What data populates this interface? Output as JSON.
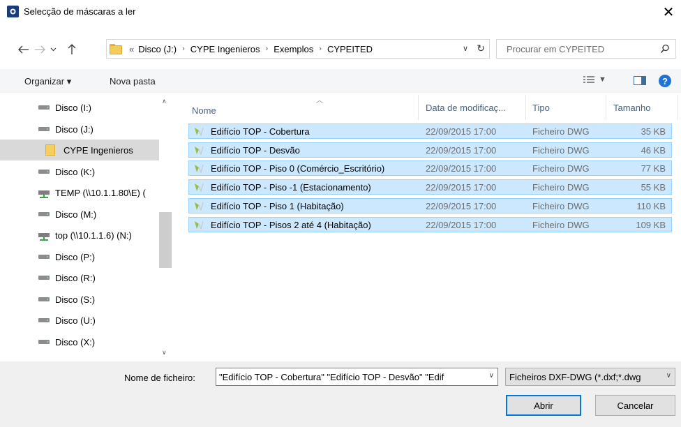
{
  "window": {
    "title": "Selecção de máscaras a ler",
    "close_glyph": "✕"
  },
  "navigation": {
    "breadcrumb": [
      "Disco (J:)",
      "CYPE Ingenieros",
      "Exemplos",
      "CYPEITED"
    ],
    "overflow_glyph": "«",
    "search_placeholder": "Procurar em CYPEITED"
  },
  "toolbar": {
    "organize_label": "Organizar ▾",
    "new_folder_label": "Nova pasta",
    "help_label": "?"
  },
  "sidebar": {
    "items": [
      {
        "label": "Disco (I:)",
        "icon": "drive-icon"
      },
      {
        "label": "Disco (J:)",
        "icon": "drive-icon"
      },
      {
        "label": "CYPE Ingenieros",
        "icon": "folder-icon",
        "selected": true
      },
      {
        "label": "Disco (K:)",
        "icon": "drive-icon"
      },
      {
        "label": "TEMP (\\\\10.1.1.80\\E) (",
        "icon": "network-drive-icon"
      },
      {
        "label": "Disco (M:)",
        "icon": "drive-icon"
      },
      {
        "label": "top (\\\\10.1.1.6) (N:)",
        "icon": "network-drive-icon"
      },
      {
        "label": "Disco (P:)",
        "icon": "drive-icon"
      },
      {
        "label": "Disco (R:)",
        "icon": "drive-icon"
      },
      {
        "label": "Disco (S:)",
        "icon": "drive-icon"
      },
      {
        "label": "Disco (U:)",
        "icon": "drive-icon"
      },
      {
        "label": "Disco (X:)",
        "icon": "drive-icon"
      }
    ]
  },
  "filelist": {
    "columns": {
      "name": "Nome",
      "date": "Data de modificaç...",
      "type": "Tipo",
      "size": "Tamanho"
    },
    "rows": [
      {
        "name": "Edifício TOP - Cobertura",
        "date": "22/09/2015 17:00",
        "type": "Ficheiro DWG",
        "size": "35 KB"
      },
      {
        "name": "Edifício TOP - Desvão",
        "date": "22/09/2015 17:00",
        "type": "Ficheiro DWG",
        "size": "46 KB"
      },
      {
        "name": "Edifício TOP - Piso 0 (Comércio_Escritório)",
        "date": "22/09/2015 17:00",
        "type": "Ficheiro DWG",
        "size": "77 KB"
      },
      {
        "name": "Edifício TOP - Piso -1 (Estacionamento)",
        "date": "22/09/2015 17:00",
        "type": "Ficheiro DWG",
        "size": "55 KB"
      },
      {
        "name": "Edifício TOP - Piso 1 (Habitação)",
        "date": "22/09/2015 17:00",
        "type": "Ficheiro DWG",
        "size": "110 KB"
      },
      {
        "name": "Edifício TOP - Pisos 2 até 4 (Habitação)",
        "date": "22/09/2015 17:00",
        "type": "Ficheiro DWG",
        "size": "109 KB"
      }
    ]
  },
  "footer": {
    "filename_label": "Nome de ficheiro:",
    "filename_value": "\"Edifício TOP - Cobertura\" \"Edifício TOP - Desvão\" \"Edif",
    "filter_value": "Ficheiros DXF-DWG (*.dxf;*.dwg",
    "open_label": "Abrir",
    "cancel_label": "Cancelar"
  },
  "colors": {
    "selection_bg": "#cce8ff",
    "selection_border": "#99d1ff",
    "accent": "#0078d7"
  }
}
